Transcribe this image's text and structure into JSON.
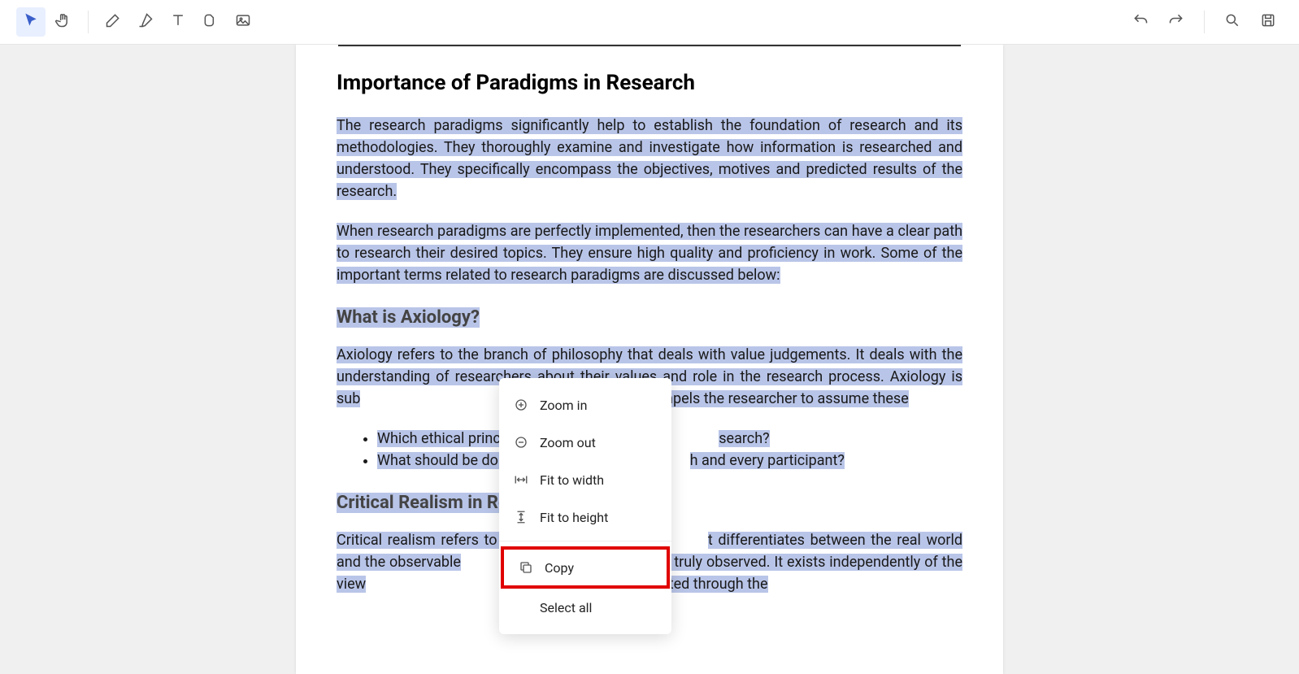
{
  "toolbar": {
    "tools": [
      "cursor",
      "hand",
      "pencil",
      "highlighter",
      "text",
      "shape",
      "image"
    ],
    "right": [
      "undo",
      "redo",
      "search",
      "save"
    ]
  },
  "document": {
    "heading1": "Importance of Paradigms in Research",
    "para1": "The research paradigms significantly help to establish the foundation of research and its methodologies. They thoroughly examine and investigate how information is researched and understood. They specifically encompass the objectives, motives and predicted results of the research.",
    "para2": "When research paradigms are perfectly implemented, then the researchers can have a clear path to research their desired topics. They ensure high quality and proficiency in work. Some of the important terms related to research paradigms are discussed below:",
    "heading2a": "What is Axiology?",
    "para3a": "Axiology refers to the branch of philosophy that deals with value judgements. It deals with the understanding of researchers about their values and role in the research process. Axiology is sub",
    "para3b": "sthetics. Axiology compels the researcher to assume these",
    "bullet1a": "Which ethical princip",
    "bullet1b": "search?",
    "bullet2a": "What should be don",
    "bullet2b": "h and every participant?",
    "heading2b_a": "Critical Realism in Re",
    "para4a": "Critical realism refers to th",
    "para4b": "t differentiates between the real world and the observable",
    "para4c": "not be truly observed. It exists independently of the view",
    "para4d": "orld is constructed through the"
  },
  "contextMenu": {
    "zoomIn": "Zoom in",
    "zoomOut": "Zoom out",
    "fitWidth": "Fit to width",
    "fitHeight": "Fit to height",
    "copy": "Copy",
    "selectAll": "Select all"
  }
}
